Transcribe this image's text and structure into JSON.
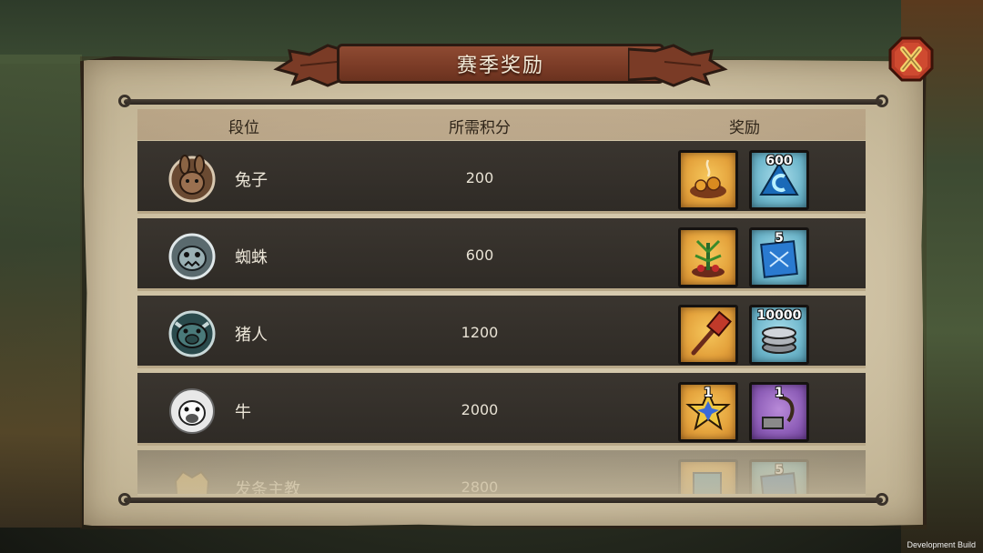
{
  "title": "赛季奖励",
  "close_label": "X",
  "headers": {
    "rank": "段位",
    "points": "所需积分",
    "rewards": "奖励"
  },
  "rows": [
    {
      "name": "兔子",
      "points": "200",
      "rewards": [
        {
          "style": "gold",
          "icon": "treasure-pile-icon",
          "count": ""
        },
        {
          "style": "blue",
          "icon": "blue-gem-icon",
          "count": "600"
        }
      ]
    },
    {
      "name": "蜘蛛",
      "points": "600",
      "rewards": [
        {
          "style": "gold",
          "icon": "plant-trap-icon",
          "count": ""
        },
        {
          "style": "blue",
          "icon": "blueprint-icon",
          "count": "5"
        }
      ]
    },
    {
      "name": "猪人",
      "points": "1200",
      "rewards": [
        {
          "style": "gold",
          "icon": "war-hammer-icon",
          "count": ""
        },
        {
          "style": "blue",
          "icon": "coin-stack-icon",
          "count": "10000"
        }
      ]
    },
    {
      "name": "牛",
      "points": "2000",
      "rewards": [
        {
          "style": "gold",
          "icon": "star-badge-icon",
          "count": "1"
        },
        {
          "style": "purple",
          "icon": "lantern-hook-icon",
          "count": "1"
        }
      ]
    },
    {
      "name": "发条主教",
      "points": "2800",
      "rewards": [
        {
          "style": "gold",
          "icon": "card-frame-icon",
          "count": ""
        },
        {
          "style": "blue",
          "icon": "blueprint-icon",
          "count": "5"
        }
      ]
    }
  ],
  "footer_note": "Development Build"
}
